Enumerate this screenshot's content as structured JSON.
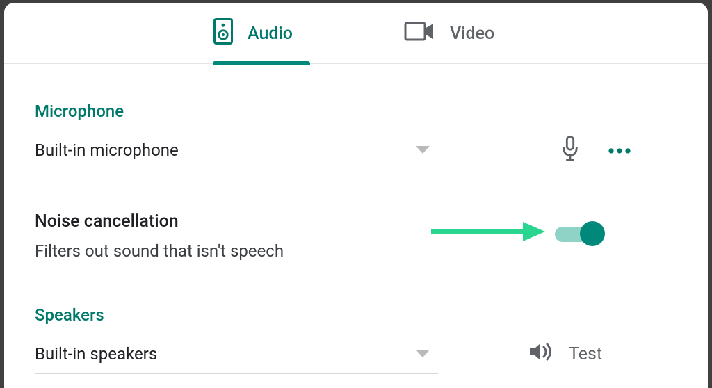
{
  "tabs": {
    "audio": {
      "label": "Audio",
      "active": true
    },
    "video": {
      "label": "Video",
      "active": false
    }
  },
  "microphone": {
    "section_label": "Microphone",
    "selected": "Built-in microphone"
  },
  "noise_cancellation": {
    "title": "Noise cancellation",
    "description": "Filters out sound that isn't speech",
    "enabled": true
  },
  "speakers": {
    "section_label": "Speakers",
    "selected": "Built-in speakers",
    "test_label": "Test"
  },
  "colors": {
    "accent": "#00897b",
    "accent_dark": "#00796b",
    "text": "#202124",
    "muted": "#5f6368",
    "arrow": "#2ad58f"
  }
}
